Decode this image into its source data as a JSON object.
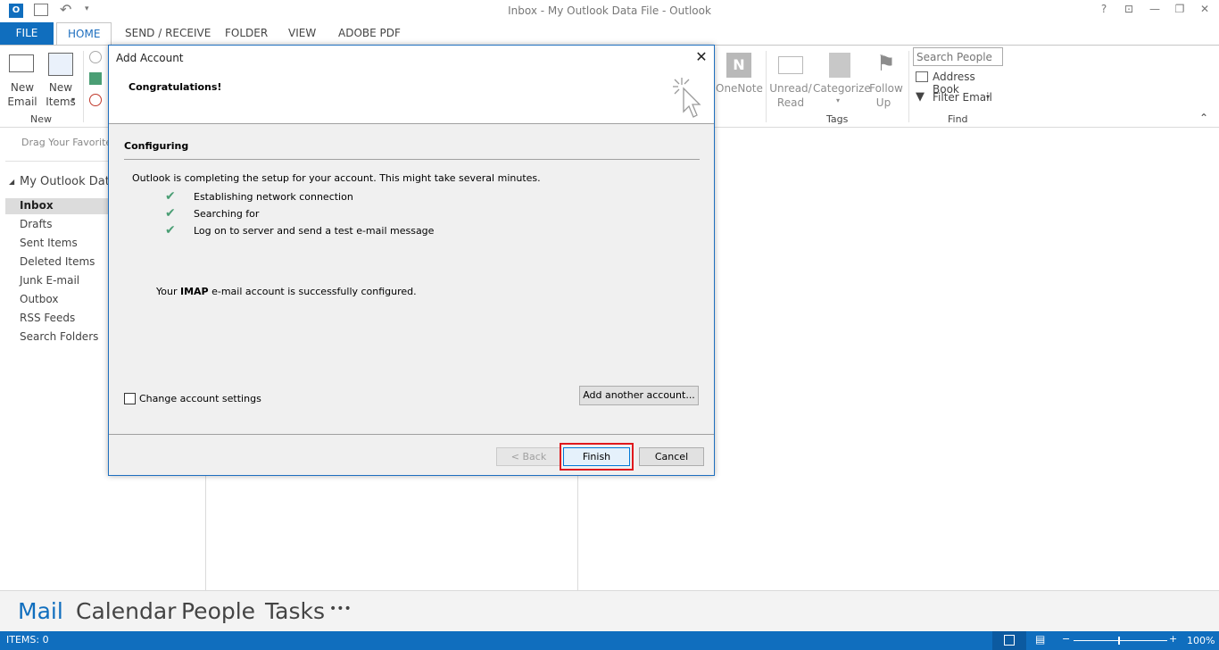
{
  "window": {
    "title": "Inbox - My Outlook Data File - Outlook"
  },
  "tabs": [
    "FILE",
    "HOME",
    "SEND / RECEIVE",
    "FOLDER",
    "VIEW",
    "ADOBE PDF"
  ],
  "ribbon": {
    "new_email_line1": "New",
    "new_email_line2": "Email",
    "new_items_line1": "New",
    "new_items_line2": "Items",
    "group_new": "New",
    "onenote": "OneNote",
    "unread_line1": "Unread/",
    "unread_line2": "Read",
    "categorize": "Categorize",
    "follow_line1": "Follow",
    "follow_line2": "Up",
    "group_tags": "Tags",
    "search_people_placeholder": "Search People",
    "address_book": "Address Book",
    "filter_email": "Filter Email",
    "group_find": "Find"
  },
  "nav": {
    "favorites_hint": "Drag Your Favorite",
    "root": "My Outlook Data",
    "folders": [
      "Inbox",
      "Drafts",
      "Sent Items",
      "Deleted Items",
      "Junk E-mail",
      "Outbox",
      "RSS Feeds",
      "Search Folders"
    ]
  },
  "bottom_nav": {
    "mail": "Mail",
    "calendar": "Calendar",
    "people": "People",
    "tasks": "Tasks",
    "more": "•••"
  },
  "status": {
    "items": "ITEMS: 0",
    "zoom": "100%"
  },
  "dialog": {
    "title": "Add Account",
    "heading": "Congratulations!",
    "section": "Configuring",
    "intro": "Outlook is completing the setup for your account. This might take several minutes.",
    "steps": [
      "Establishing network connection",
      "Searching for",
      "Log on to server and send a test e-mail message"
    ],
    "success_prefix": "Your ",
    "success_bold": "IMAP",
    "success_suffix": " e-mail account is successfully configured.",
    "change_settings": "Change account settings",
    "add_another": "Add another account...",
    "back": "< Back",
    "finish": "Finish",
    "cancel": "Cancel"
  },
  "colors": {
    "accent": "#106ebe",
    "highlight": "#e0191d",
    "check": "#4a9e74"
  }
}
